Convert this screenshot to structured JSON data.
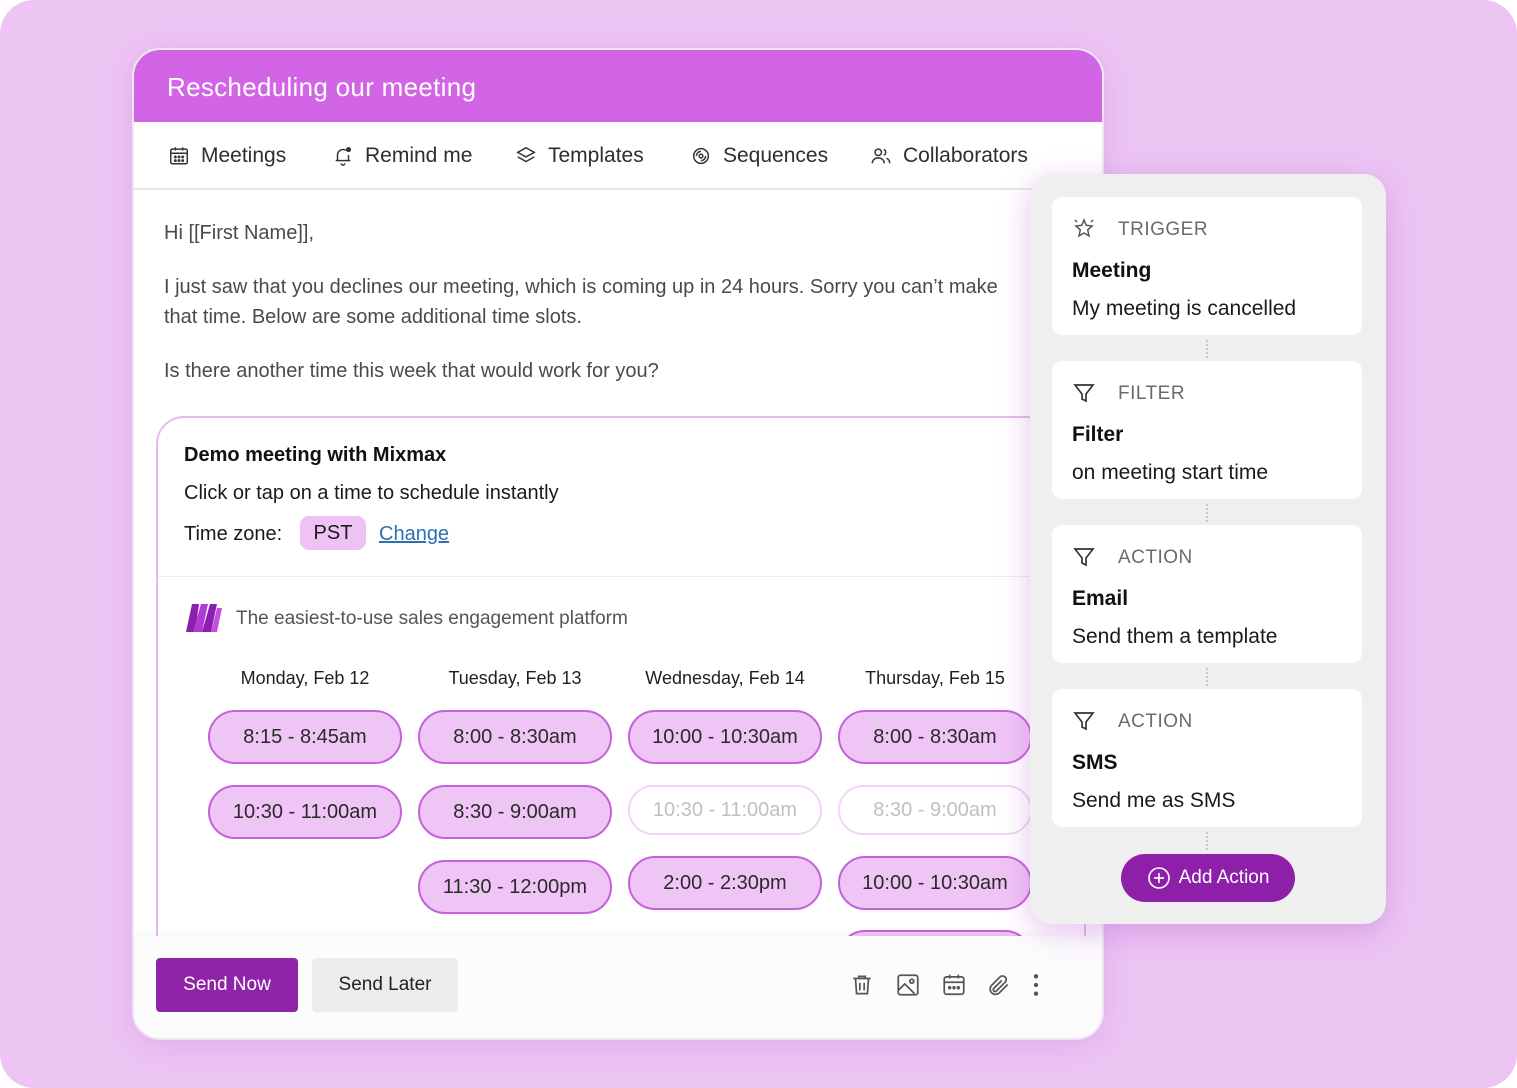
{
  "compose": {
    "subject": "Rescheduling our meeting",
    "toolbar": {
      "meetings": "Meetings",
      "remind": "Remind me",
      "templates": "Templates",
      "sequences": "Sequences",
      "collaborators": "Collaborators"
    },
    "body": {
      "greeting": "Hi [[First Name]],",
      "line1": "I just saw that you declines our meeting, which is coming up in 24 hours. Sorry you can’t make",
      "line2": "that time. Below are some additional time slots.",
      "line3": "Is there another time this week that would work for you?"
    },
    "meeting_card": {
      "title": "Demo meeting with Mixmax",
      "subtitle": "Click or tap on a time to schedule instantly",
      "timezone_label": "Time zone:",
      "timezone": "PST",
      "change_link": "Change",
      "brand_text": "The easiest-to-use sales engagement platform",
      "days": [
        {
          "label": "Monday, Feb 12",
          "slots": [
            {
              "time": "8:15 - 8:45am",
              "available": true
            },
            {
              "time": "10:30 - 11:00am",
              "available": true
            }
          ]
        },
        {
          "label": "Tuesday, Feb 13",
          "slots": [
            {
              "time": "8:00 - 8:30am",
              "available": true
            },
            {
              "time": "8:30 - 9:00am",
              "available": true
            },
            {
              "time": "11:30 - 12:00pm",
              "available": true
            }
          ]
        },
        {
          "label": "Wednesday, Feb 14",
          "slots": [
            {
              "time": "10:00 - 10:30am",
              "available": true
            },
            {
              "time": "10:30 - 11:00am",
              "available": false
            },
            {
              "time": "2:00 - 2:30pm",
              "available": true
            }
          ]
        },
        {
          "label": "Thursday, Feb 15",
          "slots": [
            {
              "time": "8:00 - 8:30am",
              "available": true
            },
            {
              "time": "8:30 - 9:00am",
              "available": false
            },
            {
              "time": "10:00 - 10:30am",
              "available": true
            }
          ]
        }
      ]
    },
    "footer": {
      "send_now": "Send Now",
      "send_later": "Send Later",
      "icons": [
        "trash-icon",
        "image-icon",
        "calendar-icon",
        "paperclip-icon",
        "more-vertical-icon"
      ]
    }
  },
  "workflow": {
    "steps": [
      {
        "kind": "TRIGGER",
        "icon": "sparkle-icon",
        "title": "Meeting",
        "desc": "My meeting is cancelled"
      },
      {
        "kind": "FILTER",
        "icon": "filter-icon",
        "title": "Filter",
        "desc": "on meeting start time"
      },
      {
        "kind": "ACTION",
        "icon": "filter-icon",
        "title": "Email",
        "desc": "Send them a template"
      },
      {
        "kind": "ACTION",
        "icon": "filter-icon",
        "title": "SMS",
        "desc": "Send me as SMS"
      }
    ],
    "add_action": "Add Action"
  },
  "colors": {
    "background": "#ecc5f3",
    "header": "#d264e6",
    "slot_fill": "#efc5f5",
    "slot_border": "#c561da",
    "primary_button": "#9024a9",
    "link": "#2d6fb2"
  }
}
